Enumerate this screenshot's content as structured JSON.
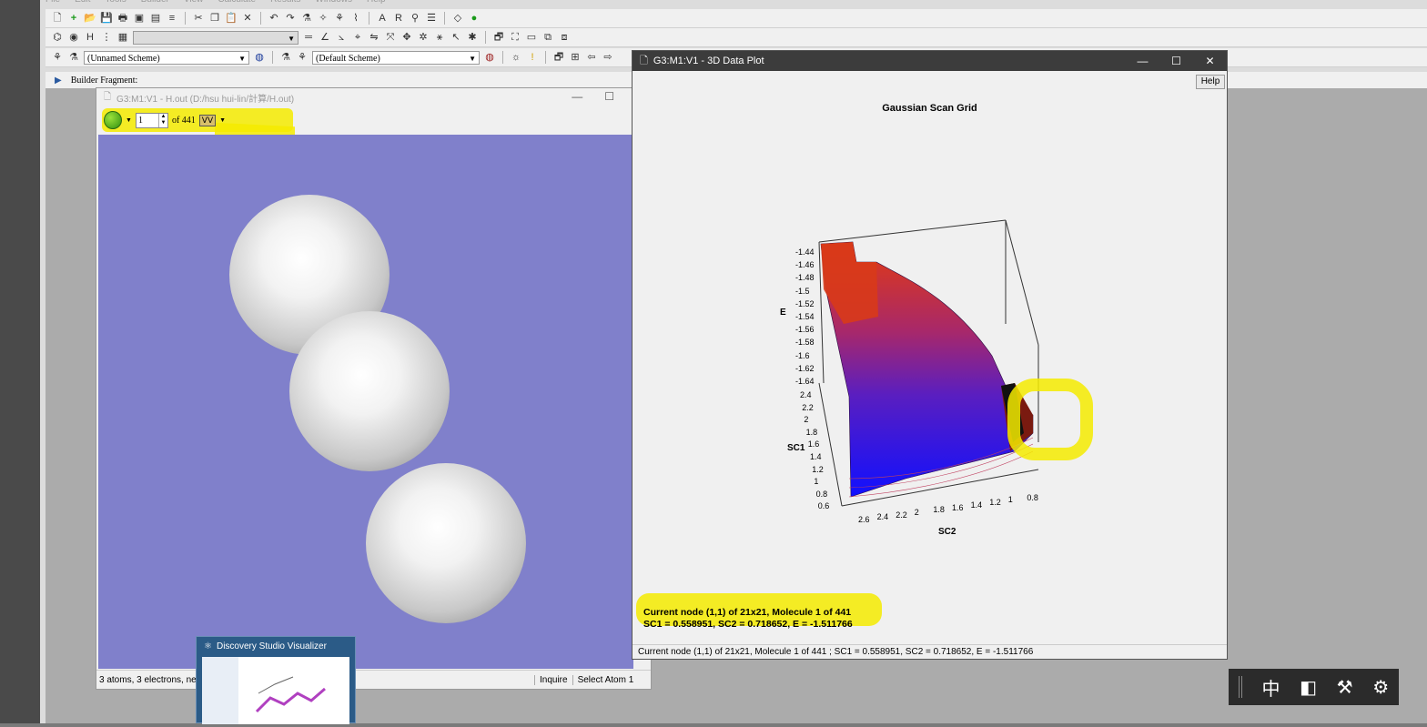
{
  "menu": [
    "File",
    "Edit",
    "Tools",
    "Builder",
    "View",
    "Calculate",
    "Results",
    "Windows",
    "Help"
  ],
  "toolbar3": {
    "scheme_left": "(Unnamed Scheme)",
    "scheme_right": "(Default Scheme)"
  },
  "builder_bar": {
    "label": "Builder Fragment:"
  },
  "mol_window": {
    "title": "G3:M1:V1 - H.out (D:/hsu hui-lin/計算/H.out)",
    "frame_value": "1",
    "frame_of": "of 441",
    "status_info": "3 atoms, 3 electrons, ne",
    "status_mode": "Inquire",
    "status_select": "Select Atom 1",
    "viewport_color": "#8080cb"
  },
  "plot_window": {
    "title": "G3:M1:V1 - 3D Data Plot",
    "help_label": "Help",
    "plot_title": "Gaussian Scan Grid",
    "axis_e": "E",
    "axis_sc1": "SC1",
    "axis_sc2": "SC2",
    "e_ticks": [
      "-1.44",
      "-1.46",
      "-1.48",
      "-1.5",
      "-1.52",
      "-1.54",
      "-1.56",
      "-1.58",
      "-1.6",
      "-1.62",
      "-1.64"
    ],
    "sc1_ticks": [
      "2.4",
      "2.2",
      "2",
      "1.8",
      "1.6",
      "1.4",
      "1.2",
      "1",
      "0.8",
      "0.6"
    ],
    "sc2_ticks": [
      "2.6",
      "2.4",
      "2.2",
      "2",
      "1.8",
      "1.6",
      "1.4",
      "1.2",
      "1",
      "0.8"
    ],
    "readout_line1": "Current node (1,1) of 21x21, Molecule 1 of 441",
    "readout_line2": "SC1 = 0.558951, SC2 = 0.718652, E = -1.511766",
    "status": "Current node (1,1) of 21x21, Molecule 1 of 441 ; SC1 = 0.558951, SC2 = 0.718652, E = -1.511766"
  },
  "taskbar_thumb": {
    "title": "Discovery Studio Visualizer"
  },
  "ime": {
    "char": "中"
  },
  "colors": {
    "highlight": "#f5eb00",
    "plot_high": "#e03a10",
    "plot_low": "#1a1aff",
    "plot_mid": "#8a2a9a"
  }
}
